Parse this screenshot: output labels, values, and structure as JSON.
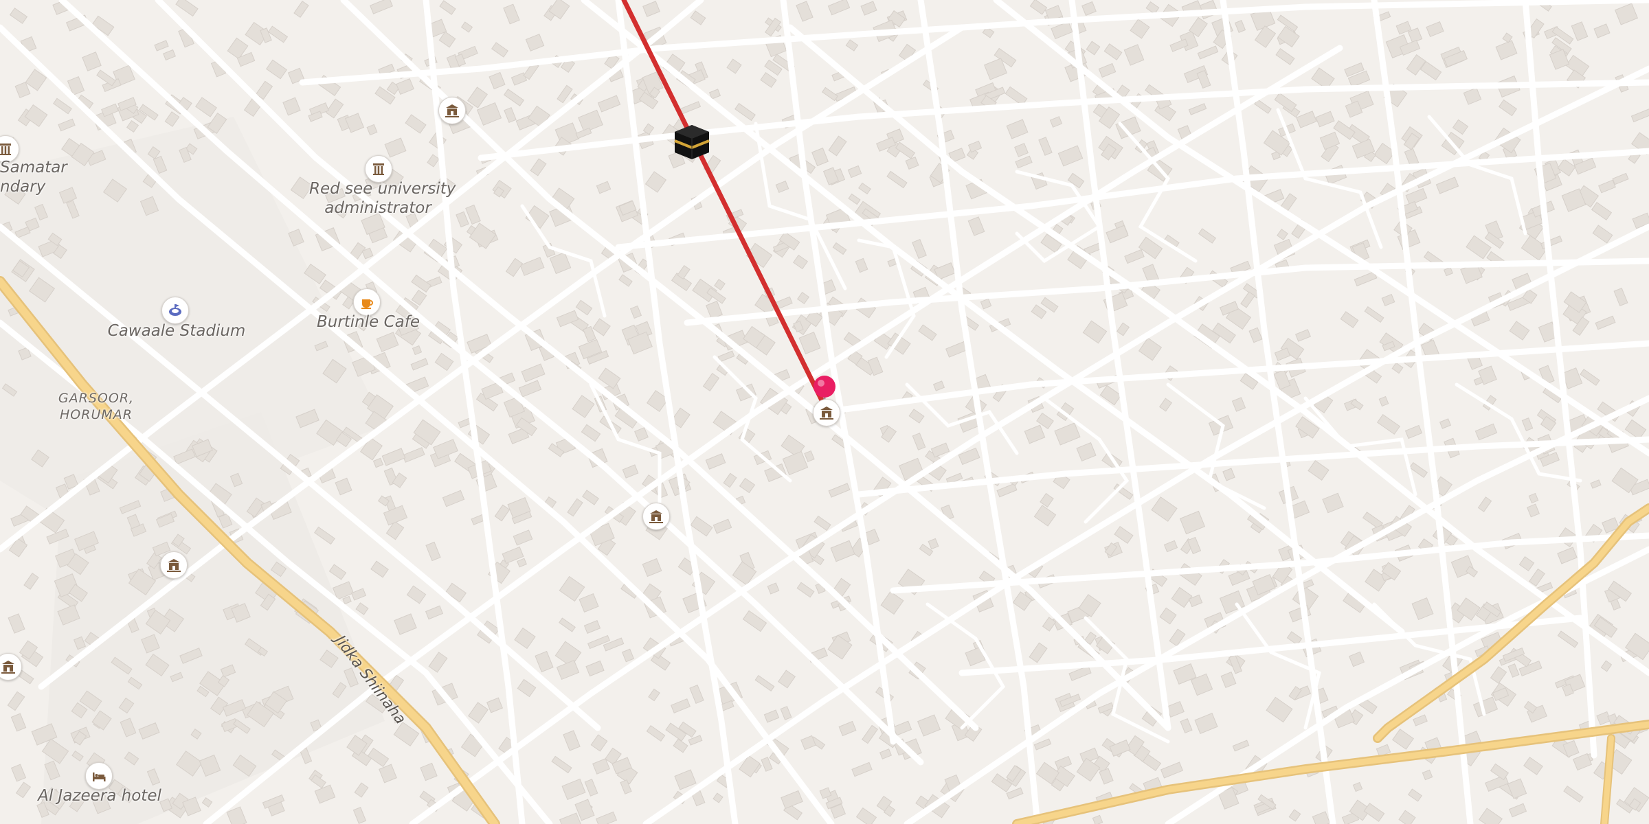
{
  "map": {
    "labels": {
      "samatar": "Samatar",
      "samatar_2": "ndary",
      "red_see_1": "Red see university",
      "red_see_2": "administrator",
      "burtinle": "Burtinle Cafe",
      "cawaale": "Cawaale Stadium",
      "garsoor_1": "GARSOOR,",
      "garsoor_2": "HORUMAR",
      "al_jazeera": "Al Jazeera hotel",
      "street": "Jidka Shiinaha"
    },
    "icons": {
      "university": "university-icon",
      "museum": "museum-icon",
      "cafe": "cafe-icon",
      "stadium": "stadium-icon",
      "hotel": "hotel-icon",
      "kaaba": "kaaba-icon",
      "pin": "location-pin-icon"
    },
    "colors": {
      "route": "#d32f2f",
      "major_road": "#f7d58b",
      "pin": "#e91e63",
      "background": "#f3f0ec"
    }
  }
}
